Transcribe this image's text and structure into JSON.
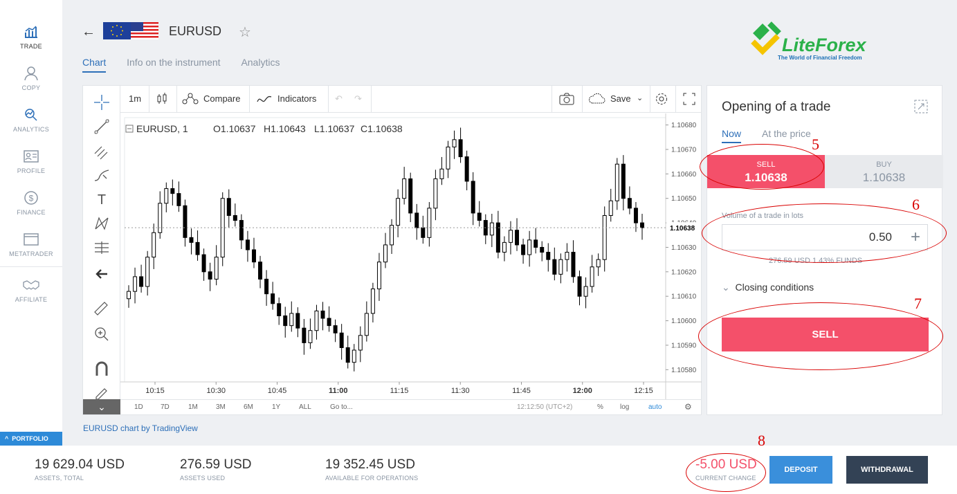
{
  "sidebar": {
    "items": [
      {
        "label": "TRADE",
        "icon": "chart-bars-icon",
        "active": true
      },
      {
        "label": "COPY",
        "icon": "person-icon",
        "active": false
      },
      {
        "label": "ANALYTICS",
        "icon": "analytics-icon",
        "active": false
      },
      {
        "label": "PROFILE",
        "icon": "id-card-icon",
        "active": false
      },
      {
        "label": "FINANCE",
        "icon": "dollar-coin-icon",
        "active": false
      },
      {
        "label": "METATRADER",
        "icon": "window-icon",
        "active": false
      },
      {
        "label": "AFFILIATE",
        "icon": "handshake-icon",
        "active": false
      }
    ],
    "portfolio_label": "PORTFOLIO"
  },
  "header": {
    "symbol": "EURUSD",
    "tabs": [
      {
        "label": "Chart",
        "active": true
      },
      {
        "label": "Info on the instrument",
        "active": false
      },
      {
        "label": "Analytics",
        "active": false
      }
    ],
    "logo_name": "LiteForex",
    "logo_tagline": "The World of Financial Freedom"
  },
  "chart_toolbar": {
    "interval": "1m",
    "compare": "Compare",
    "indicators": "Indicators",
    "save": "Save"
  },
  "chart_bottom": {
    "ranges": [
      "1D",
      "7D",
      "1M",
      "3M",
      "6M",
      "1Y",
      "ALL"
    ],
    "goto": "Go to...",
    "time": "12:12:50 (UTC+2)",
    "percent": "%",
    "log": "log",
    "auto": "auto"
  },
  "chart_legend": {
    "symbol": "EURUSD, 1",
    "open": "O1.10637",
    "high": "H1.10643",
    "low": "L1.10637",
    "close": "C1.10638"
  },
  "chart_data": {
    "type": "candlestick",
    "symbol": "EURUSD",
    "interval": "1m",
    "x_ticks": [
      "10:15",
      "10:30",
      "10:45",
      "11:00",
      "11:15",
      "11:30",
      "11:45",
      "12:00",
      "12:15"
    ],
    "y_ticks": [
      1.1058,
      1.1059,
      1.106,
      1.1061,
      1.1062,
      1.1063,
      1.1064,
      1.1065,
      1.1066,
      1.1067,
      1.1068
    ],
    "ylim": [
      1.10575,
      1.10683
    ],
    "last_price": 1.10638,
    "close_series": [
      1.10612,
      1.10618,
      1.10614,
      1.10626,
      1.10636,
      1.10648,
      1.10654,
      1.10652,
      1.10647,
      1.10634,
      1.10632,
      1.10627,
      1.1062,
      1.10617,
      1.10626,
      1.1065,
      1.10643,
      1.10641,
      1.10633,
      1.10629,
      1.10624,
      1.10617,
      1.10611,
      1.10607,
      1.10602,
      1.10598,
      1.10603,
      1.10597,
      1.10591,
      1.10596,
      1.10604,
      1.10601,
      1.10598,
      1.10595,
      1.10589,
      1.10583,
      1.10588,
      1.10594,
      1.10603,
      1.10613,
      1.10624,
      1.10631,
      1.10639,
      1.1065,
      1.10658,
      1.10644,
      1.10638,
      1.10634,
      1.10646,
      1.10658,
      1.10662,
      1.10671,
      1.10674,
      1.10667,
      1.10657,
      1.10644,
      1.10641,
      1.10635,
      1.1064,
      1.10628,
      1.10632,
      1.10637,
      1.10631,
      1.10627,
      1.10633,
      1.1063,
      1.10628,
      1.10625,
      1.10619,
      1.10625,
      1.10628,
      1.10618,
      1.1061,
      1.10614,
      1.10622,
      1.10625,
      1.10643,
      1.10649,
      1.10664,
      1.1065,
      1.10646,
      1.1064,
      1.10638
    ]
  },
  "trade_panel": {
    "title": "Opening of a trade",
    "mode_now": "Now",
    "mode_at_price": "At the price",
    "sell_label": "SELL",
    "sell_price": "1.10638",
    "buy_label": "BUY",
    "buy_price": "1.10638",
    "volume_label": "Volume of a trade in lots",
    "volume_value": "0.50",
    "funds_info": "276.59  USD  1.43%  FUNDS",
    "closing_conditions": "Closing conditions",
    "sell_button": "SELL"
  },
  "chart_credit": "EURUSD chart by TradingView",
  "footer": {
    "assets_total": {
      "value": "19 629.04 USD",
      "label": "ASSETS, TOTAL"
    },
    "assets_used": {
      "value": "276.59 USD",
      "label": "ASSETS USED"
    },
    "available": {
      "value": "19 352.45 USD",
      "label": "AVAILABLE FOR OPERATIONS"
    },
    "current_change": {
      "value": "-5.00 USD",
      "label": "CURRENT CHANGE"
    },
    "deposit": "DEPOSIT",
    "withdrawal": "WITHDRAWAL"
  },
  "annotations": [
    "5",
    "6",
    "7",
    "8"
  ],
  "colors": {
    "sell": "#f4506a",
    "accent": "#2d6fb8",
    "annotation": "#d90000",
    "withdraw": "#334255",
    "deposit": "#3a8fdb"
  }
}
